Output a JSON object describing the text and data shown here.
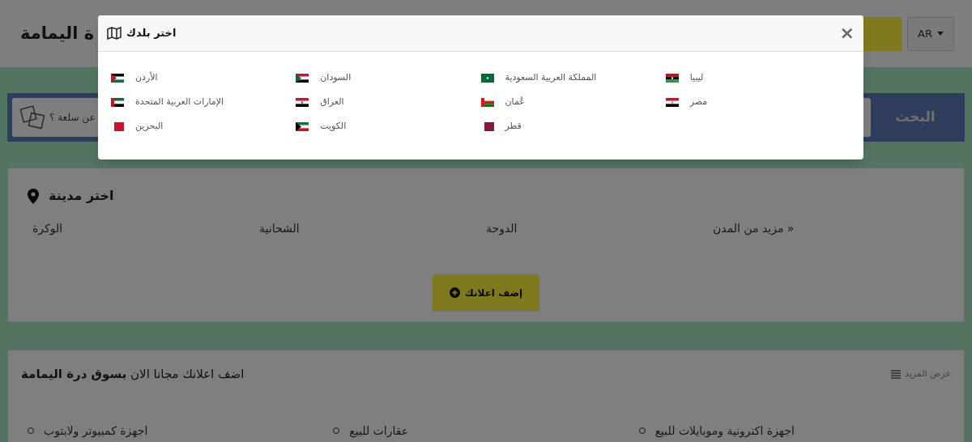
{
  "header": {
    "title": "ة اليمامة",
    "language": "AR"
  },
  "search": {
    "value": "عن سلعة ؟",
    "button": "البحث"
  },
  "city_card": {
    "title": "اختر مدينة",
    "cities": [
      "« مزيد من المدن",
      "الدوحة",
      "الشحانية",
      "الوكرة"
    ],
    "add_button": "إضف اعلانك"
  },
  "promo_card": {
    "title": "اضف اعلانك مجانا الان **بسوق درة اليمامة**",
    "more_link": "عرض المزيد",
    "categories": [
      "اجهزة اكترونية وموبايلات للبيع",
      "عقارات للبيع",
      "اجهزة كمبيوتر ولابتوب"
    ]
  },
  "modal": {
    "title": "اختر بلدك",
    "close": "×",
    "columns": [
      [
        "ليبيا",
        "مصر"
      ],
      [
        "المملكة العربية السعودية",
        "عُمان",
        "قطر"
      ],
      [
        "السودان",
        "العراق",
        "الكويت"
      ],
      [
        "الأردن",
        "الإمارات العربية المتحدة",
        "البحرين"
      ]
    ]
  }
}
